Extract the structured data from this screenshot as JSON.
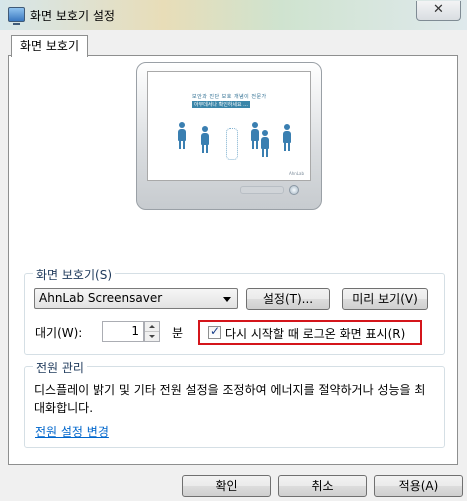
{
  "window": {
    "title": "화면 보호기 설정",
    "close_label": "✕"
  },
  "tab": {
    "label": "화면 보호기"
  },
  "preview": {
    "line1": "보안과 진단 보호 개념이 전문가",
    "line2": "아무데서나 확인하세요 ...",
    "footer": "AhnLab"
  },
  "screensaver_group": {
    "legend": "화면 보호기(S)",
    "selected": "AhnLab Screensaver",
    "settings_button": "설정(T)...",
    "preview_button": "미리 보기(V)",
    "wait_label": "대기(W):",
    "wait_value": "1",
    "wait_unit": "분",
    "logon_checkbox_label": "다시 시작할 때 로그온 화면 표시(R)",
    "logon_checked": true
  },
  "power_group": {
    "legend": "전원 관리",
    "description": "디스플레이 밝기 및 기타 전원 설정을 조정하여 에너지를 절약하거나 성능을 최대화합니다.",
    "link": "전원 설정 변경"
  },
  "footer_buttons": {
    "ok": "확인",
    "cancel": "취소",
    "apply": "적용(A)"
  },
  "colors": {
    "highlight_box": "#d4151b",
    "link": "#0066cc",
    "legend_text": "#1e395b"
  }
}
